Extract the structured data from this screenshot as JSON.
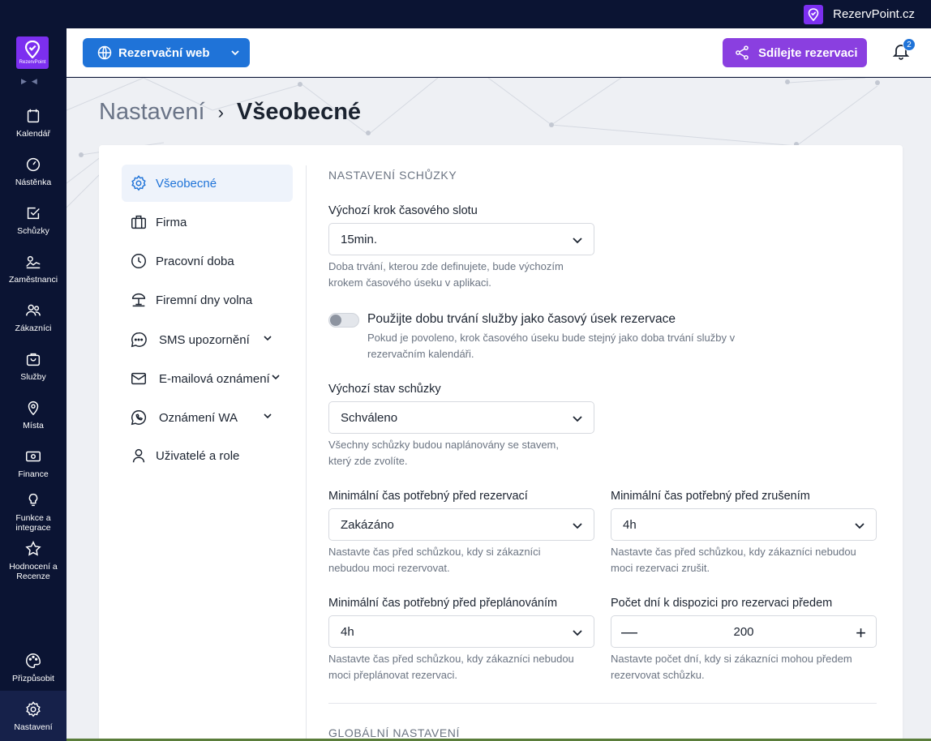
{
  "system_bar": {
    "brand": "RezervPoint.cz"
  },
  "sidebar": {
    "logo_text": "RezervPoint",
    "items": [
      {
        "label": "Kalendář",
        "icon": "calendar-icon"
      },
      {
        "label": "Nástěnka",
        "icon": "dashboard-icon"
      },
      {
        "label": "Schůzky",
        "icon": "checkbox-icon"
      },
      {
        "label": "Zaměstnanci",
        "icon": "employees-icon"
      },
      {
        "label": "Zákazníci",
        "icon": "customers-icon"
      },
      {
        "label": "Služby",
        "icon": "bag-icon"
      },
      {
        "label": "Místa",
        "icon": "location-icon"
      },
      {
        "label": "Finance",
        "icon": "money-icon"
      },
      {
        "label": "Funkce a integrace",
        "icon": "bulb-icon"
      },
      {
        "label": "Hodnocení a Recenze",
        "icon": "star-icon"
      },
      {
        "label": "Přizpůsobit",
        "icon": "palette-icon"
      },
      {
        "label": "Nastavení",
        "icon": "gear-icon"
      }
    ]
  },
  "header": {
    "web_button": "Rezervační web",
    "share_button": "Sdílejte rezervaci",
    "notification_count": "2"
  },
  "breadcrumb": {
    "parent": "Nastavení",
    "current": "Všeobecné"
  },
  "settings_menu": [
    {
      "label": "Všeobecné",
      "icon": "gear-icon"
    },
    {
      "label": "Firma",
      "icon": "briefcase-icon"
    },
    {
      "label": "Pracovní doba",
      "icon": "clock-icon"
    },
    {
      "label": "Firemní dny volna",
      "icon": "beach-icon"
    },
    {
      "label": "SMS upozornění",
      "icon": "chat-icon"
    },
    {
      "label": "E-mailová oznámení",
      "icon": "mail-icon"
    },
    {
      "label": "Oznámení WA",
      "icon": "whatsapp-icon"
    },
    {
      "label": "Uživatelé a role",
      "icon": "user-icon"
    }
  ],
  "form": {
    "section_title": "NASTAVENÍ SCHŮZKY",
    "slot_step": {
      "label": "Výchozí krok časového slotu",
      "value": "15min.",
      "help_1": "Doba trvání, kterou zde definujete, bude výchozím",
      "help_2": "krokem časového úseku v aplikaci."
    },
    "toggle": {
      "title": "Použijte dobu trvání služby jako časový úsek rezervace",
      "help_1": "Pokud je povoleno, krok časového úseku bude stejný jako doba trvání služby v",
      "help_2": "rezervačním kalendáři."
    },
    "default_status": {
      "label": "Výchozí stav schůzky",
      "value": "Schváleno",
      "help_1": "Všechny schůzky budou naplánovány se stavem,",
      "help_2": "který zde zvolíte."
    },
    "min_before_booking": {
      "label": "Minimální čas potřebný před rezervací",
      "value": "Zakázáno",
      "help_1": "Nastavte čas před schůzkou, kdy si zákazníci",
      "help_2": "nebudou moci rezervovat."
    },
    "min_before_cancel": {
      "label": "Minimální čas potřebný před zrušením",
      "value": "4h",
      "help_1": "Nastavte čas před schůzkou, kdy zákazníci nebudou",
      "help_2": "moci rezervaci zrušit."
    },
    "min_before_reschedule": {
      "label": "Minimální čas potřebný před přeplánováním",
      "value": "4h",
      "help_1": "Nastavte čas před schůzkou, kdy zákazníci nebudou",
      "help_2": "moci přeplánovat rezervaci."
    },
    "days_ahead": {
      "label": "Počet dní k dispozici pro rezervaci předem",
      "value": "200",
      "help_1": "Nastavte počet dní, kdy si zákazníci mohou předem",
      "help_2": "rezervovat schůzku."
    },
    "section_title_2": "GLOBÁLNÍ NASTAVENÍ"
  }
}
